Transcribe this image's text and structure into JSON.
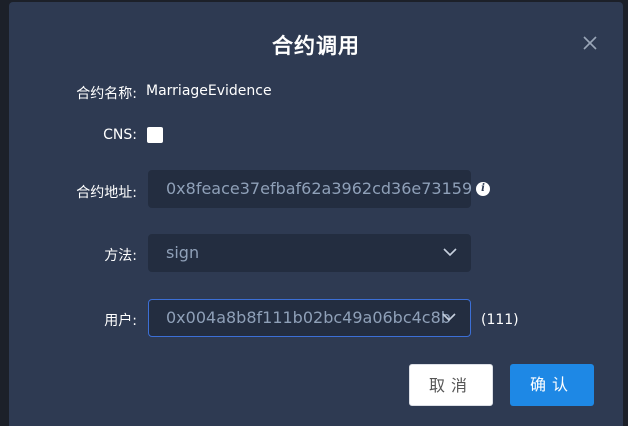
{
  "dialog": {
    "title": "合约调用",
    "close_icon": "close-icon"
  },
  "form": {
    "contract_name_label": "合约名称:",
    "contract_name_value": "MarriageEvidence",
    "cns_label": "CNS:",
    "cns_checked": false,
    "contract_address_label": "合约地址:",
    "contract_address_value": "0x8feace37efbaf62a3962cd36e73159",
    "method_label": "方法:",
    "method_value": "sign",
    "user_label": "用户:",
    "user_value": "0x004a8b8f111b02bc49a06bc4c8b",
    "user_suffix": "(111)"
  },
  "buttons": {
    "cancel_label": "取消",
    "confirm_label": "确认"
  },
  "colors": {
    "dialog_bg": "#2e3a52",
    "field_bg": "#232d40",
    "primary": "#1e88e5",
    "active_border": "#3c6fd6"
  }
}
